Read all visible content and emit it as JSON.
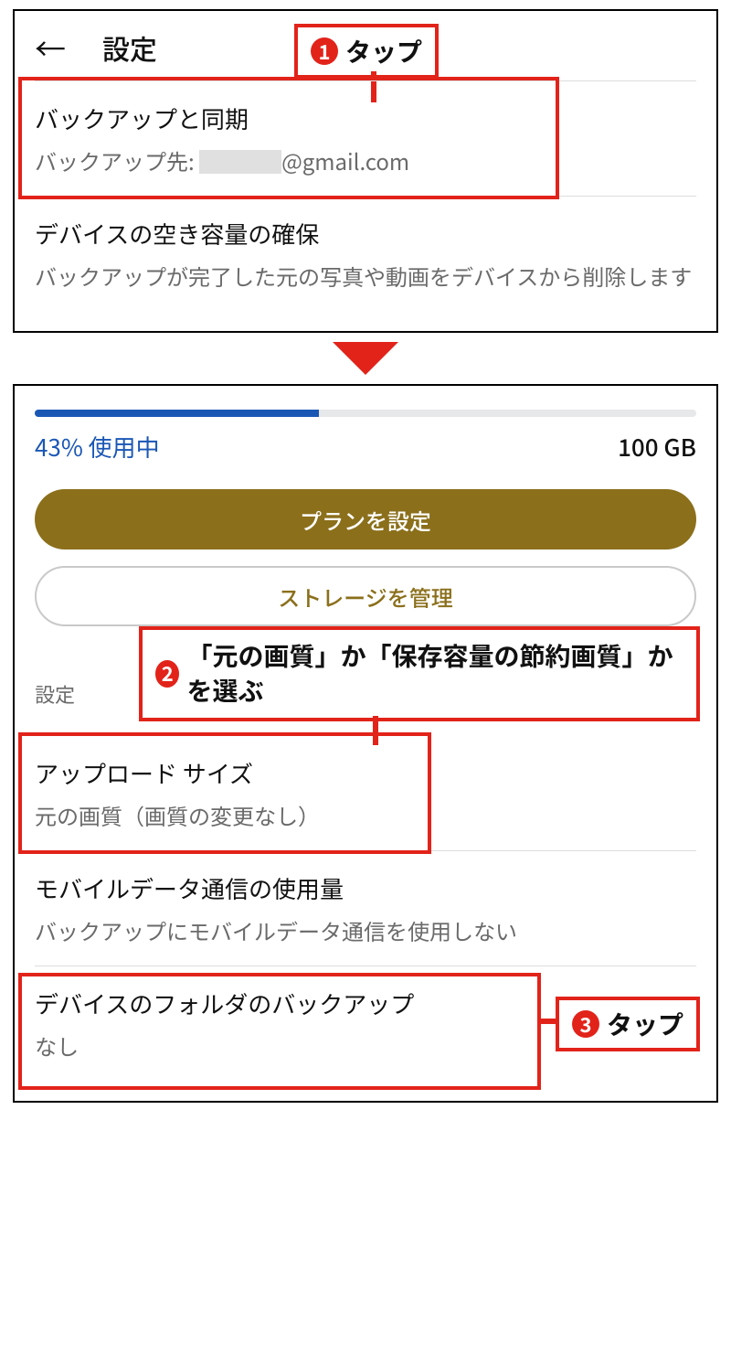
{
  "panel1": {
    "header": {
      "title": "設定"
    },
    "callout1": {
      "num": "1",
      "text": "タップ"
    },
    "rows": [
      {
        "title": "バックアップと同期",
        "sub_label": "バックアップ先:",
        "sub_suffix": "@gmail.com"
      },
      {
        "title": "デバイスの空き容量の確保",
        "sub": "バックアップが完了した元の写真や動画をデバイスから削除します"
      }
    ]
  },
  "panel2": {
    "storage": {
      "percent_text": "43% 使用中",
      "percent_value": 43,
      "total": "100 GB"
    },
    "buttons": {
      "primary": "プランを設定",
      "outline": "ストレージを管理"
    },
    "section_label": "設定",
    "callout2": {
      "num": "2",
      "text": "「元の画質」か「保存容量の節約画質」かを選ぶ"
    },
    "rows": [
      {
        "title": "アップロード サイズ",
        "sub": "元の画質（画質の変更なし）"
      },
      {
        "title": "モバイルデータ通信の使用量",
        "sub": "バックアップにモバイルデータ通信を使用しない"
      },
      {
        "title": "デバイスのフォルダのバックアップ",
        "sub": "なし"
      }
    ],
    "callout3": {
      "num": "3",
      "text": "タップ"
    }
  }
}
